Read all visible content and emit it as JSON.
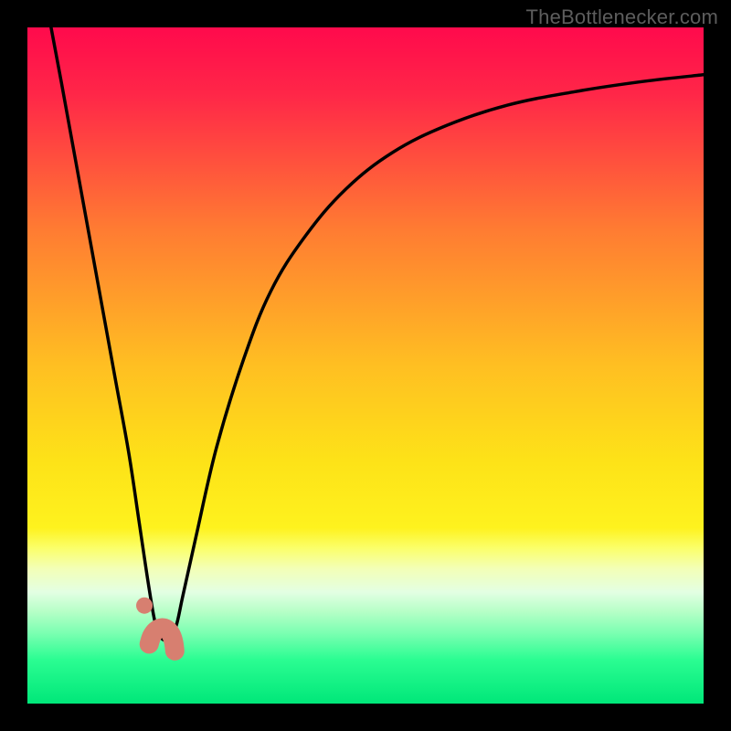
{
  "attribution": "TheBottlenecker.com",
  "colors": {
    "frame": "#000000",
    "gradient_stops": [
      {
        "offset": 0.0,
        "color": "#ff0a4c"
      },
      {
        "offset": 0.1,
        "color": "#ff2748"
      },
      {
        "offset": 0.3,
        "color": "#ff7c32"
      },
      {
        "offset": 0.5,
        "color": "#ffbf22"
      },
      {
        "offset": 0.64,
        "color": "#fde218"
      },
      {
        "offset": 0.74,
        "color": "#fef21e"
      },
      {
        "offset": 0.77,
        "color": "#fbff6a"
      },
      {
        "offset": 0.8,
        "color": "#f3ffb6"
      },
      {
        "offset": 0.835,
        "color": "#e3ffe3"
      },
      {
        "offset": 0.865,
        "color": "#b4ffc6"
      },
      {
        "offset": 0.895,
        "color": "#7cffb2"
      },
      {
        "offset": 0.935,
        "color": "#2bfd92"
      },
      {
        "offset": 1.0,
        "color": "#00e779"
      }
    ],
    "curve": "#000000",
    "marker_fill": "#d77f70",
    "marker_stroke": "#d77f70"
  },
  "chart_data": {
    "type": "line",
    "title": "",
    "xlabel": "",
    "ylabel": "",
    "xlim": [
      0,
      100
    ],
    "ylim": [
      0,
      100
    ],
    "series": [
      {
        "name": "left-branch",
        "x": [
          3.5,
          5,
          7,
          9,
          11,
          13,
          15,
          16.5,
          18
        ],
        "y": [
          100,
          92,
          81,
          70,
          59,
          48,
          37,
          27,
          17
        ]
      },
      {
        "name": "valley",
        "x": [
          18,
          19,
          20,
          21,
          22,
          23
        ],
        "y": [
          17,
          11.5,
          9.5,
          9.8,
          11.5,
          16
        ]
      },
      {
        "name": "right-branch",
        "x": [
          23,
          25,
          28,
          32,
          36,
          41,
          47,
          54,
          62,
          71,
          81,
          91,
          100
        ],
        "y": [
          16,
          25,
          38,
          51,
          61,
          69,
          76,
          81.5,
          85.5,
          88.5,
          90.5,
          92,
          93
        ]
      }
    ],
    "markers": {
      "dot": {
        "x": 17.3,
        "y": 14.5
      },
      "hook": [
        {
          "x": 18.0,
          "y": 8.8
        },
        {
          "x": 18.4,
          "y": 10.0
        },
        {
          "x": 19.0,
          "y": 10.8
        },
        {
          "x": 19.8,
          "y": 11.2
        },
        {
          "x": 20.6,
          "y": 11.0
        },
        {
          "x": 21.2,
          "y": 10.3
        },
        {
          "x": 21.6,
          "y": 9.2
        },
        {
          "x": 21.8,
          "y": 7.8
        }
      ]
    }
  }
}
